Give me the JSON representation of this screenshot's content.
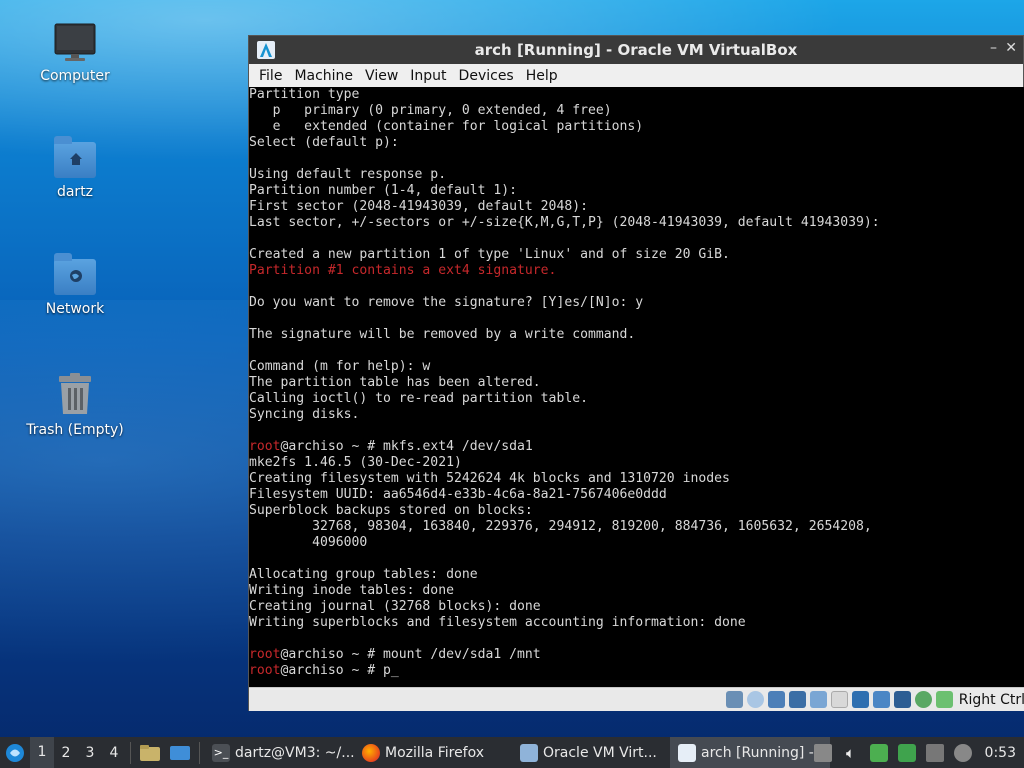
{
  "desktop": {
    "icons": [
      {
        "label": "Computer"
      },
      {
        "label": "dartz"
      },
      {
        "label": "Network"
      },
      {
        "label": "Trash (Empty)"
      }
    ]
  },
  "vbox": {
    "title": "arch [Running] - Oracle VM VirtualBox",
    "menu": [
      "File",
      "Machine",
      "View",
      "Input",
      "Devices",
      "Help"
    ],
    "host_key_label": "Right Ctrl"
  },
  "terminal": {
    "prompt_user": "root",
    "prompt_host": "@archiso ~ # ",
    "lines_a": [
      "Partition type",
      "   p   primary (0 primary, 0 extended, 4 free)",
      "   e   extended (container for logical partitions)",
      "Select (default p):",
      "",
      "Using default response p.",
      "Partition number (1-4, default 1):",
      "First sector (2048-41943039, default 2048):",
      "Last sector, +/-sectors or +/-size{K,M,G,T,P} (2048-41943039, default 41943039):",
      "",
      "Created a new partition 1 of type 'Linux' and of size 20 GiB."
    ],
    "warning": "Partition #1 contains a ext4 signature.",
    "lines_b": [
      "",
      "Do you want to remove the signature? [Y]es/[N]o: y",
      "",
      "The signature will be removed by a write command.",
      "",
      "Command (m for help): w",
      "The partition table has been altered.",
      "Calling ioctl() to re-read partition table.",
      "Syncing disks.",
      ""
    ],
    "cmd1": "mkfs.ext4 /dev/sda1",
    "lines_c": [
      "mke2fs 1.46.5 (30-Dec-2021)",
      "Creating filesystem with 5242624 4k blocks and 1310720 inodes",
      "Filesystem UUID: aa6546d4-e33b-4c6a-8a21-7567406e0ddd",
      "Superblock backups stored on blocks:",
      "        32768, 98304, 163840, 229376, 294912, 819200, 884736, 1605632, 2654208,",
      "        4096000",
      "",
      "Allocating group tables: done",
      "Writing inode tables: done",
      "Creating journal (32768 blocks): done",
      "Writing superblocks and filesystem accounting information: done",
      ""
    ],
    "cmd2": "mount /dev/sda1 /mnt",
    "cmd3": "p_"
  },
  "taskbar": {
    "workspaces": [
      "1",
      "2",
      "3",
      "4"
    ],
    "tasks": [
      {
        "label": "dartz@VM3: ~/..."
      },
      {
        "label": "Mozilla Firefox"
      },
      {
        "label": "Oracle VM Virt..."
      },
      {
        "label": "arch [Running] -..."
      }
    ],
    "clock": "0:53"
  }
}
